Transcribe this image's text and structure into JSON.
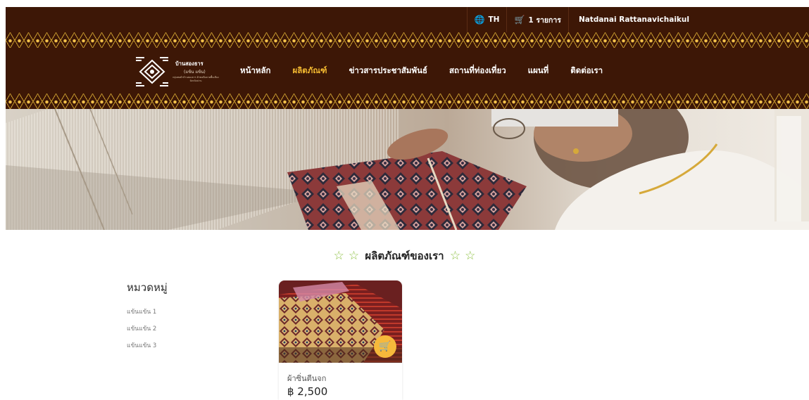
{
  "topbar": {
    "language": "TH",
    "language_icon": "globe-icon",
    "cart_label": "1 รายการ",
    "cart_icon": "cart-icon",
    "user_name": "Natdanai Rattanavichaikul"
  },
  "logo": {
    "title": "บ้านสองธาร",
    "subtitle": "(แข้น แข้น)",
    "small_text": "กลุ่มทอผ้าบ้านสองธาร ผ้าทอมือลายพื้นเมือง จังหวัดน่าน"
  },
  "nav": {
    "items": [
      {
        "label": "หน้าหลัก",
        "active": false
      },
      {
        "label": "ผลิตภัณฑ์",
        "active": true
      },
      {
        "label": "ข่าวสารประชาสัมพันธ์",
        "active": false
      },
      {
        "label": "สถานที่ท่องเที่ยว",
        "active": false
      },
      {
        "label": "แผนที่",
        "active": false
      },
      {
        "label": "ติดต่อเรา",
        "active": false
      }
    ]
  },
  "section": {
    "title": "ผลิตภัณฑ์ของเรา",
    "decor_icon": "star-outline-icon"
  },
  "sidebar": {
    "title": "หมวดหมู่",
    "items": [
      "แข้นแข้น 1",
      "แข้นแข้น 2",
      "แข้นแข้น 3"
    ]
  },
  "products": [
    {
      "name": "ผ้าซิ่นตีนจก",
      "price": "฿ 2,500",
      "cart_icon": "cart-icon"
    }
  ],
  "colors": {
    "header_bg": "#3d1706",
    "active_nav": "#f2b830",
    "star": "#8bbf3f",
    "cart_button": "#f6b93b"
  }
}
